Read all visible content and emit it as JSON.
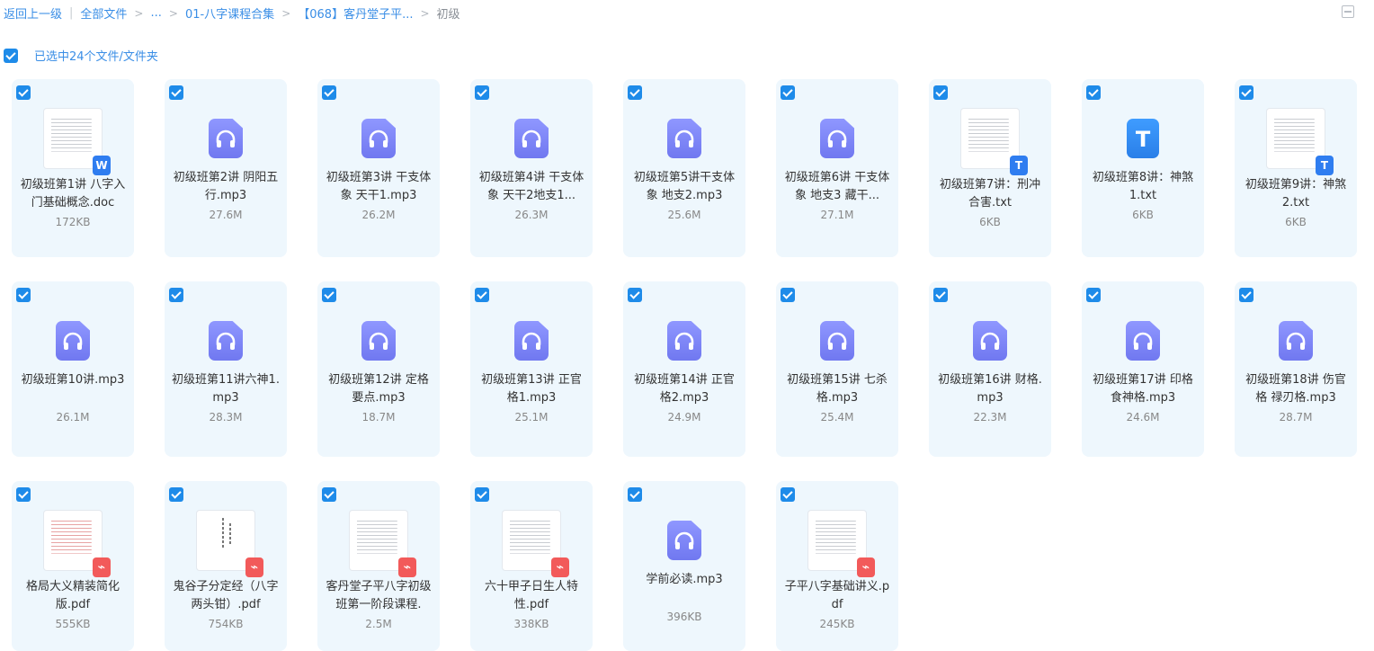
{
  "breadcrumb": {
    "back": "返回上一级",
    "all": "全部文件",
    "ellipsis": "...",
    "folder1": "01-八字课程合集",
    "folder2": "【068】客丹堂子平...",
    "current": "初级"
  },
  "selection": {
    "text": "已选中24个文件/文件夹"
  },
  "files": [
    {
      "name": "初级班第1讲 八字入门基础概念.doc",
      "size": "172KB",
      "type": "doc"
    },
    {
      "name": "初级班第2讲 阴阳五行.mp3",
      "size": "27.6M",
      "type": "audio"
    },
    {
      "name": "初级班第3讲 干支体象 天干1.mp3",
      "size": "26.2M",
      "type": "audio"
    },
    {
      "name": "初级班第4讲 干支体象 天干2地支1...",
      "size": "26.3M",
      "type": "audio"
    },
    {
      "name": "初级班第5讲干支体象 地支2.mp3",
      "size": "25.6M",
      "type": "audio"
    },
    {
      "name": "初级班第6讲 干支体象 地支3 藏干...",
      "size": "27.1M",
      "type": "audio"
    },
    {
      "name": "初级班第7讲：刑冲合害.txt",
      "size": "6KB",
      "type": "txtthumb"
    },
    {
      "name": "初级班第8讲：神煞1.txt",
      "size": "6KB",
      "type": "txt"
    },
    {
      "name": "初级班第9讲：神煞2.txt",
      "size": "6KB",
      "type": "txtthumb"
    },
    {
      "name": "初级班第10讲.mp3",
      "size": "26.1M",
      "type": "audio"
    },
    {
      "name": "初级班第11讲六神1.mp3",
      "size": "28.3M",
      "type": "audio"
    },
    {
      "name": "初级班第12讲 定格要点.mp3",
      "size": "18.7M",
      "type": "audio"
    },
    {
      "name": "初级班第13讲 正官格1.mp3",
      "size": "25.1M",
      "type": "audio"
    },
    {
      "name": "初级班第14讲 正官格2.mp3",
      "size": "24.9M",
      "type": "audio"
    },
    {
      "name": "初级班第15讲 七杀格.mp3",
      "size": "25.4M",
      "type": "audio"
    },
    {
      "name": "初级班第16讲 财格.mp3",
      "size": "22.3M",
      "type": "audio"
    },
    {
      "name": "初级班第17讲 印格食神格.mp3",
      "size": "24.6M",
      "type": "audio"
    },
    {
      "name": "初级班第18讲 伤官格 禄刃格.mp3",
      "size": "28.7M",
      "type": "audio"
    },
    {
      "name": "格局大义精装简化版.pdf",
      "size": "555KB",
      "type": "pdfred"
    },
    {
      "name": "鬼谷子分定经（八字两头钳）.pdf",
      "size": "754KB",
      "type": "pdfvert"
    },
    {
      "name": "客丹堂子平八字初级班第一阶段课程.",
      "size": "2.5M",
      "type": "pdf"
    },
    {
      "name": "六十甲子日生人特性.pdf",
      "size": "338KB",
      "type": "pdf"
    },
    {
      "name": "学前必读.mp3",
      "size": "396KB",
      "type": "audio"
    },
    {
      "name": "子平八字基础讲义.pdf",
      "size": "245KB",
      "type": "pdf"
    }
  ]
}
